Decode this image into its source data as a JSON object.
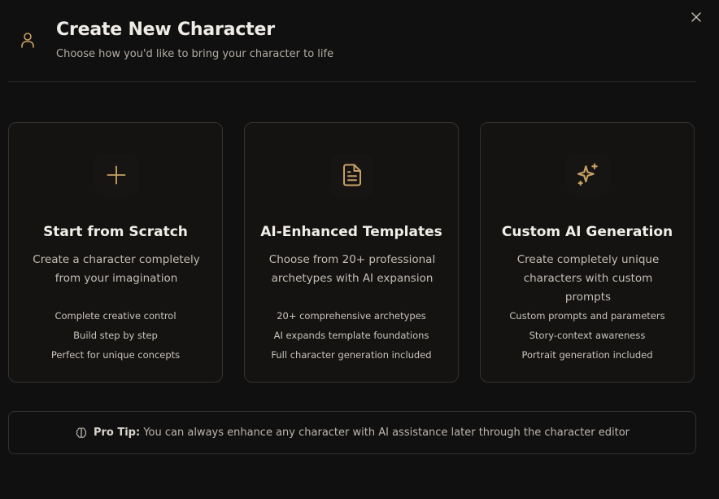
{
  "header": {
    "title": "Create New Character",
    "subtitle": "Choose how you'd like to bring your character to life"
  },
  "colors": {
    "accent": "#c8a063",
    "background": "#111010",
    "border": "#34312d"
  },
  "cards": [
    {
      "icon": "plus-icon",
      "title": "Start from Scratch",
      "description": "Create a character completely from your imagination",
      "features": [
        "Complete creative control",
        "Build step by step",
        "Perfect for unique concepts"
      ]
    },
    {
      "icon": "file-text-icon",
      "title": "AI-Enhanced Templates",
      "description": "Choose from 20+ professional archetypes with AI expansion",
      "features": [
        "20+ comprehensive archetypes",
        "AI expands template foundations",
        "Full character generation included"
      ]
    },
    {
      "icon": "sparkles-icon",
      "title": "Custom AI Generation",
      "description": "Create completely unique characters with custom prompts",
      "features": [
        "Custom prompts and parameters",
        "Story-context awareness",
        "Portrait generation included"
      ]
    }
  ],
  "tip": {
    "icon": "brain-icon",
    "label": "Pro Tip:",
    "text": "You can always enhance any character with AI assistance later through the character editor"
  }
}
